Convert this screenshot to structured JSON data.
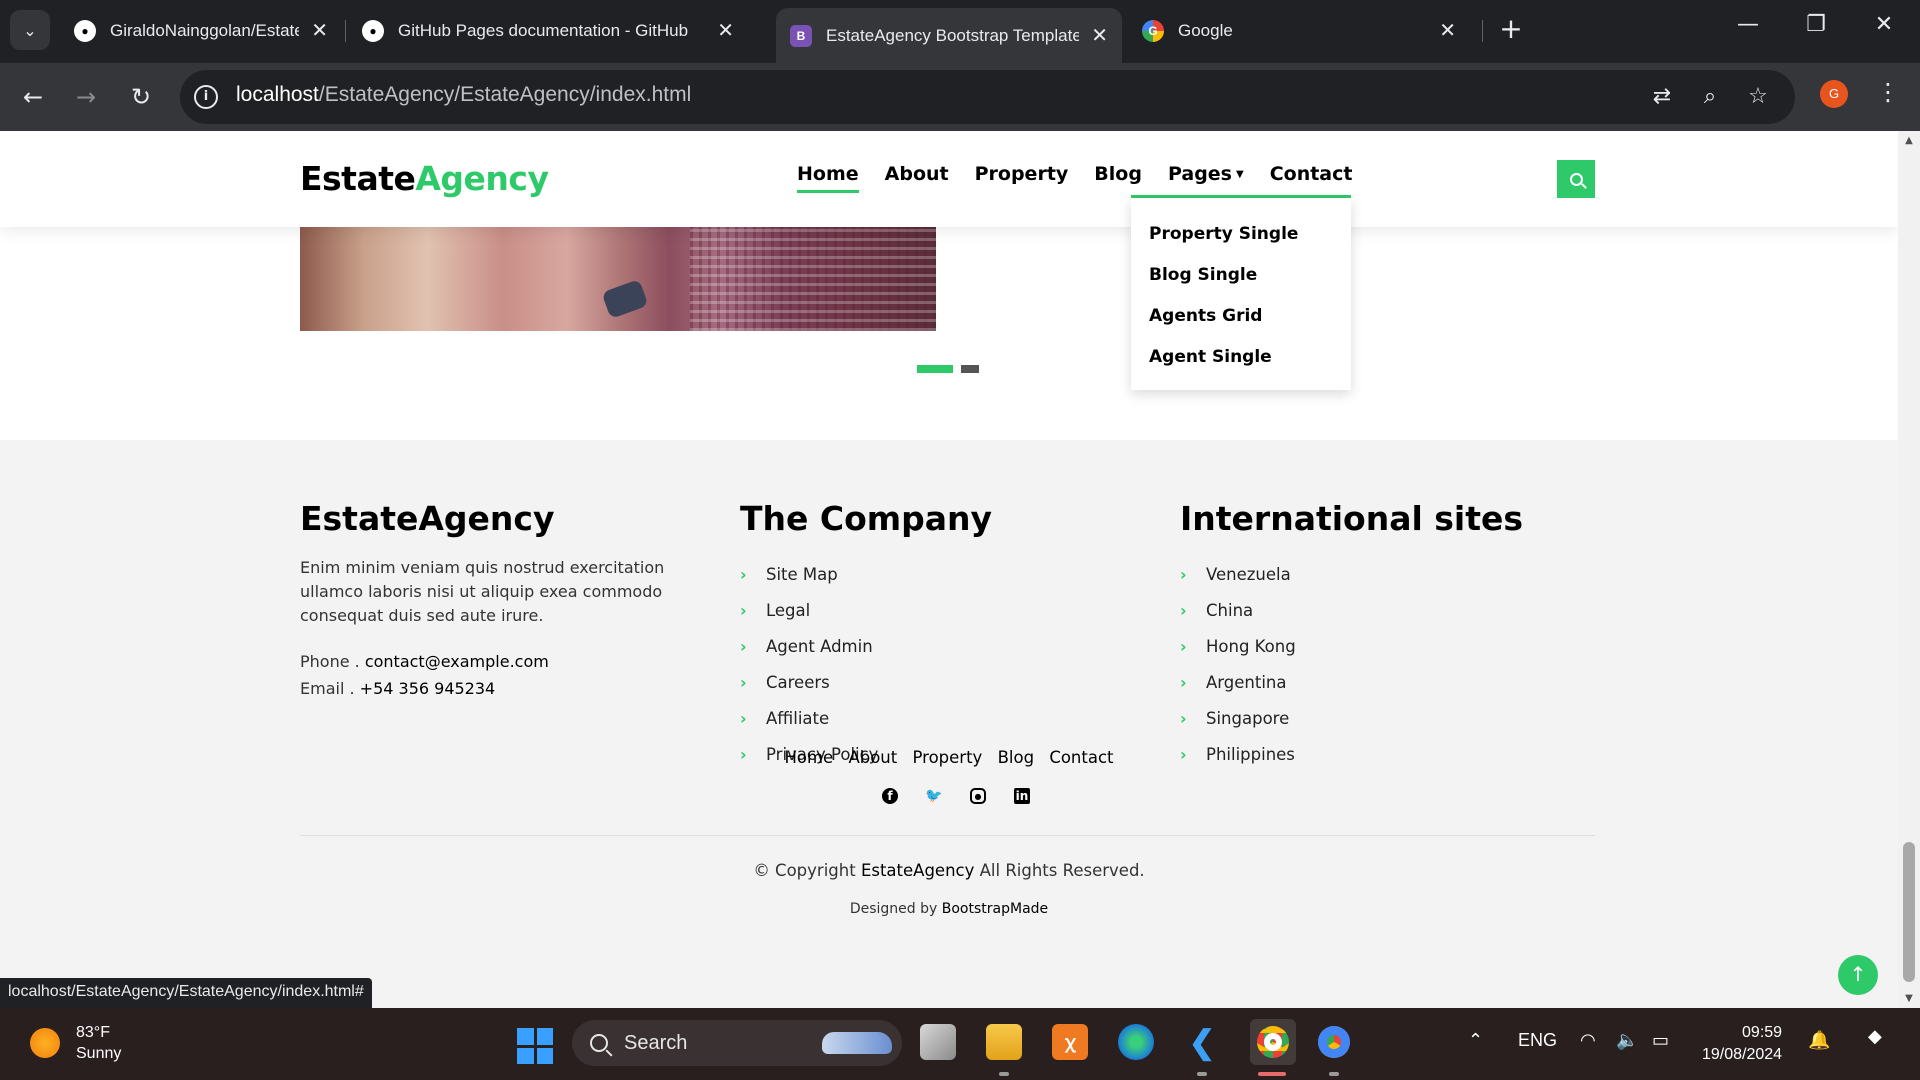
{
  "browser": {
    "tabs": [
      {
        "title": "GiraldoNainggolan/EstateAgency",
        "icon": "github-icon",
        "active": false
      },
      {
        "title": "GitHub Pages documentation - GitHub",
        "icon": "github-icon",
        "active": false
      },
      {
        "title": "EstateAgency Bootstrap Template",
        "icon": "bootstrap-icon",
        "active": true
      },
      {
        "title": "Google",
        "icon": "google-icon",
        "active": false
      }
    ],
    "url_host": "localhost",
    "url_path": "/EstateAgency/EstateAgency/index.html",
    "profile_initial": "G",
    "status_url": "localhost/EstateAgency/EstateAgency/index.html#"
  },
  "site": {
    "brand_main": "Estate",
    "brand_accent": "Agency",
    "menu": [
      "Home",
      "About",
      "Property",
      "Blog",
      "Pages",
      "Contact"
    ],
    "dropdown": [
      "Property Single",
      "Blog Single",
      "Agents Grid",
      "Agent Single"
    ],
    "accent_color": "#2eca6a"
  },
  "footer": {
    "about": {
      "title": "EstateAgency",
      "text": "Enim minim veniam quis nostrud exercitation ullamco laboris nisi ut aliquip exea commodo consequat duis sed aute irure.",
      "phone_label": "Phone .",
      "phone_value": "contact@example.com",
      "email_label": "Email .",
      "email_value": "+54 356 945234"
    },
    "company": {
      "title": "The Company",
      "links": [
        "Site Map",
        "Legal",
        "Agent Admin",
        "Careers",
        "Affiliate",
        "Privacy Policy"
      ]
    },
    "international": {
      "title": "International sites",
      "links": [
        "Venezuela",
        "China",
        "Hong Kong",
        "Argentina",
        "Singapore",
        "Philippines"
      ]
    },
    "bottom_links": [
      "Home",
      "About",
      "Property",
      "Blog",
      "Contact"
    ],
    "social": [
      "facebook-icon",
      "twitter-icon",
      "instagram-icon",
      "linkedin-icon"
    ],
    "copyright_prefix": "© Copyright",
    "copyright_brand": "EstateAgency",
    "copyright_suffix": "All Rights Reserved.",
    "designed_prefix": "Designed by",
    "designed_by": "BootstrapMade"
  },
  "taskbar": {
    "temperature": "83°F",
    "condition": "Sunny",
    "search_placeholder": "Search",
    "language": "ENG",
    "time": "09:59",
    "date": "19/08/2024"
  }
}
